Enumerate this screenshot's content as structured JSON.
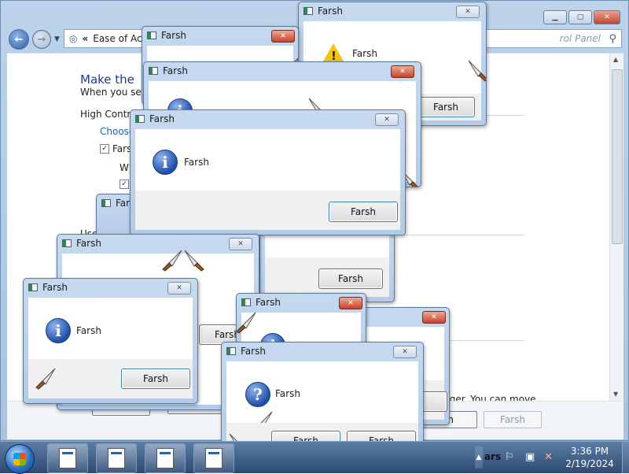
{
  "control_panel": {
    "breadcrumb": "Ease of Acc",
    "search_placeholder": "rol Panel",
    "heading": "Make the",
    "subheading": "When you sele",
    "high_contrast": "High Contra",
    "choose_link": "Choose",
    "checkbox1_label": "Farsh",
    "checkbox2_label": "Wh",
    "use_text": "Use",
    "hint_text": "rger. You can move",
    "footer_apply": "sh",
    "footer_disabled": "Farsh",
    "footer_left1": "Farsh",
    "footer_left2": "Farsh"
  },
  "dialogs": {
    "title": "Farsh",
    "message": "Farsh",
    "button": "Farsh"
  },
  "taskbar": {
    "clock_time": "3:36 PM",
    "clock_date": "2/19/2024",
    "tray_partial": "ars"
  },
  "icons": {
    "info": "information-icon",
    "question": "question-icon",
    "warning": "warning-icon",
    "knife": "knife-icon"
  },
  "colors": {
    "link": "#1a5fb4",
    "heading": "#1e3b8c",
    "close_red": "#c5432b",
    "taskbar": "#2e4b72"
  }
}
